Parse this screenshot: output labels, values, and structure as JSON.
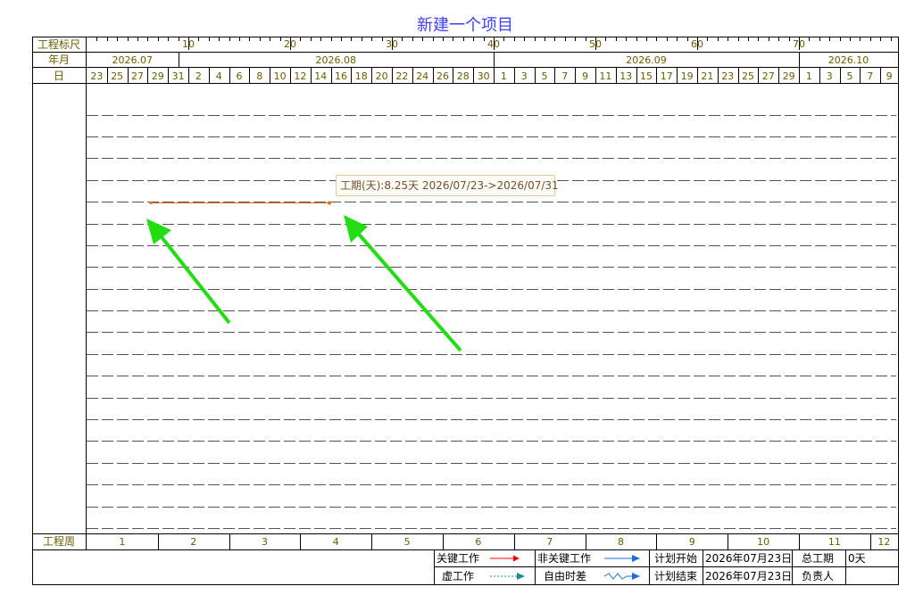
{
  "title": "新建一个项目",
  "header": {
    "row_scale_label": "工程标尺",
    "row_month_label": "年月",
    "row_day_label": "日",
    "scale_marks": [
      "10",
      "20",
      "30",
      "40",
      "50",
      "60",
      "70"
    ],
    "months": [
      "2026.07",
      "2026.08",
      "2026.09",
      "2026.10"
    ],
    "days": [
      "23",
      "25",
      "27",
      "29",
      "31",
      "2",
      "4",
      "6",
      "8",
      "10",
      "12",
      "14",
      "16",
      "18",
      "20",
      "22",
      "24",
      "26",
      "28",
      "30",
      "1",
      "3",
      "5",
      "7",
      "9",
      "11",
      "13",
      "15",
      "17",
      "19",
      "21",
      "23",
      "25",
      "27",
      "29",
      "1",
      "3",
      "5",
      "7",
      "9"
    ]
  },
  "footer": {
    "week_label": "工程周",
    "weeks": [
      "1",
      "2",
      "3",
      "4",
      "5",
      "6",
      "7",
      "8",
      "9",
      "10",
      "11",
      "12"
    ]
  },
  "legend": {
    "critical_work": "关键工作",
    "non_critical_work": "非关键工作",
    "dummy_work": "虚工作",
    "free_float": "自由时差",
    "plan_start_label": "计划开始",
    "plan_start_value": "2026年07月23日",
    "plan_end_label": "计划结束",
    "plan_end_value": "2026年07月23日",
    "total_duration_label": "总工期",
    "total_duration_value": "0天",
    "owner_label": "负责人",
    "owner_value": ""
  },
  "task_tooltip": "工期(天):8.25天  2026/07/23->2026/07/31",
  "colors": {
    "header_text": "#6b5b00",
    "title": "#3f3fff",
    "critical_arrow": "#ff0000",
    "non_critical_arrow": "#1e6fd9",
    "dummy_arrow": "#1e8a8a",
    "free_float_arrow": "#1e6fd9",
    "task_bar": "#e07020",
    "annotation_arrow": "#22dd11"
  },
  "icons": [
    "critical-arrow-icon",
    "non-critical-arrow-icon",
    "dummy-arrow-icon",
    "free-float-arrow-icon",
    "annotation-arrow-icon"
  ]
}
